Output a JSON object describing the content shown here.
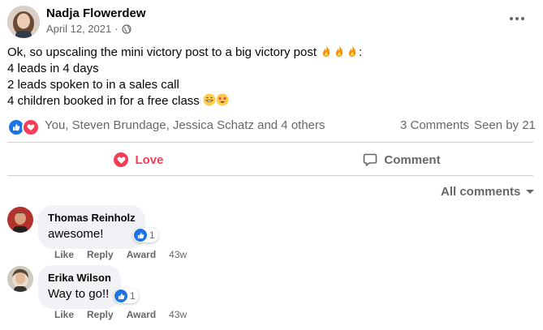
{
  "post": {
    "author": "Nadja Flowerdew",
    "date": "April 12, 2021",
    "separator": "·",
    "privacy_icon": "globe-icon",
    "lines": [
      "Ok, so upscaling the mini victory post to a big victory post",
      "4 leads in 4 days",
      "2 leads spoken to in a sales call",
      "4 children booked in for a free class"
    ],
    "line1_suffix": ":",
    "more_icon": "more-options-icon"
  },
  "reactions": {
    "summary": "You, Steven Brundage, Jessica Schatz and 4 others",
    "comments": "3 Comments",
    "seen": "Seen by 21",
    "like_color": "#1b74e4",
    "love_color": "#f33e58"
  },
  "actions": {
    "love_label": "Love",
    "comment_label": "Comment"
  },
  "filter": {
    "label": "All comments"
  },
  "comments": [
    {
      "author": "Thomas Reinholz",
      "text": "awesome!",
      "like_count": "1",
      "like_label": "Like",
      "reply_label": "Reply",
      "award_label": "Award",
      "time": "43w"
    },
    {
      "author": "Erika Wilson",
      "text": "Way to go!!",
      "like_count": "1",
      "like_label": "Like",
      "reply_label": "Reply",
      "award_label": "Award",
      "time": "43w"
    }
  ]
}
